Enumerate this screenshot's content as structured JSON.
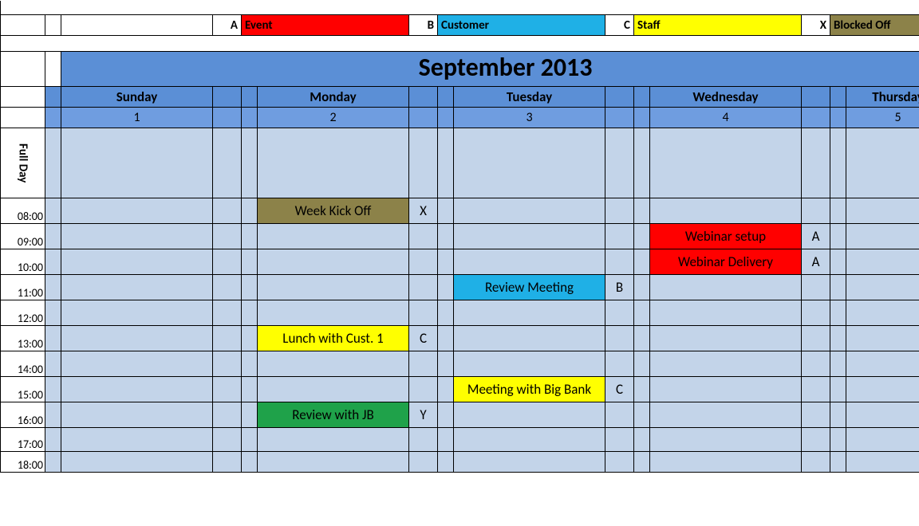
{
  "legend": [
    {
      "letter": "A",
      "label": "Event",
      "color": "c-red"
    },
    {
      "letter": "B",
      "label": "Customer",
      "color": "c-blue"
    },
    {
      "letter": "C",
      "label": "Staff",
      "color": "c-yellow"
    },
    {
      "letter": "X",
      "label": "Blocked Off",
      "color": "c-olive"
    }
  ],
  "title": "September 2013",
  "fullday_label": "Full Day",
  "days": [
    {
      "name": "Sunday",
      "date": "1"
    },
    {
      "name": "Monday",
      "date": "2"
    },
    {
      "name": "Tuesday",
      "date": "3"
    },
    {
      "name": "Wednesday",
      "date": "4"
    },
    {
      "name": "Thursday",
      "date": "5"
    }
  ],
  "times": [
    "08:00",
    "09:00",
    "10:00",
    "11:00",
    "12:00",
    "13:00",
    "14:00",
    "15:00",
    "16:00",
    "17:00",
    "18:00"
  ],
  "events": {
    "mon_0800": {
      "text": "Week Kick Off",
      "code": "X",
      "color": "c-olive"
    },
    "mon_1300": {
      "text": "Lunch with Cust. 1",
      "code": "C",
      "color": "c-yellow"
    },
    "mon_1600": {
      "text": "Review with JB",
      "code": "Y",
      "color": "c-green"
    },
    "tue_1100": {
      "text": "Review Meeting",
      "code": "B",
      "color": "c-blue"
    },
    "tue_1500": {
      "text": "Meeting with Big Bank",
      "code": "C",
      "color": "c-yellow"
    },
    "wed_0900": {
      "text": "Webinar setup",
      "code": "A",
      "color": "c-red"
    },
    "wed_1000": {
      "text": "Webinar Delivery",
      "code": "A",
      "color": "c-red"
    }
  }
}
